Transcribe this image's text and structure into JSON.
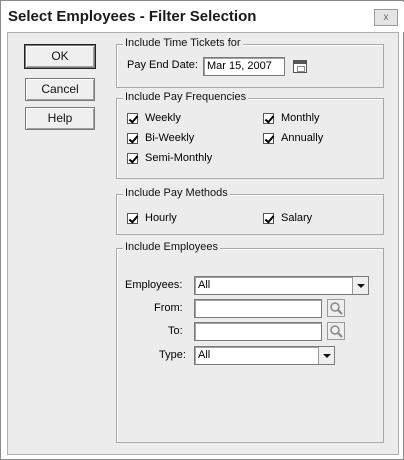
{
  "window": {
    "title": "Select Employees - Filter Selection",
    "close_label": "x"
  },
  "buttons": {
    "ok": "OK",
    "cancel": "Cancel",
    "help": "Help"
  },
  "time_tickets": {
    "legend": "Include Time Tickets for",
    "pay_end_date_label": "Pay End Date:",
    "pay_end_date_value": "Mar 15, 2007"
  },
  "pay_frequencies": {
    "legend": "Include Pay Frequencies",
    "options": [
      {
        "label": "Weekly",
        "checked": true
      },
      {
        "label": "Monthly",
        "checked": true
      },
      {
        "label": "Bi-Weekly",
        "checked": true
      },
      {
        "label": "Annually",
        "checked": true
      },
      {
        "label": "Semi-Monthly",
        "checked": true
      }
    ]
  },
  "pay_methods": {
    "legend": "Include Pay Methods",
    "options": [
      {
        "label": "Hourly",
        "checked": true
      },
      {
        "label": "Salary",
        "checked": true
      }
    ]
  },
  "employees": {
    "legend": "Include Employees",
    "employees_label": "Employees:",
    "employees_value": "All",
    "from_label": "From:",
    "from_value": "",
    "to_label": "To:",
    "to_value": "",
    "type_label": "Type:",
    "type_value": "All"
  },
  "icons": {
    "close": "close-icon",
    "calendar": "calendar-icon",
    "search": "magnifier-icon",
    "dropdown": "chevron-down-icon",
    "checkbox": "checkmark-icon"
  }
}
